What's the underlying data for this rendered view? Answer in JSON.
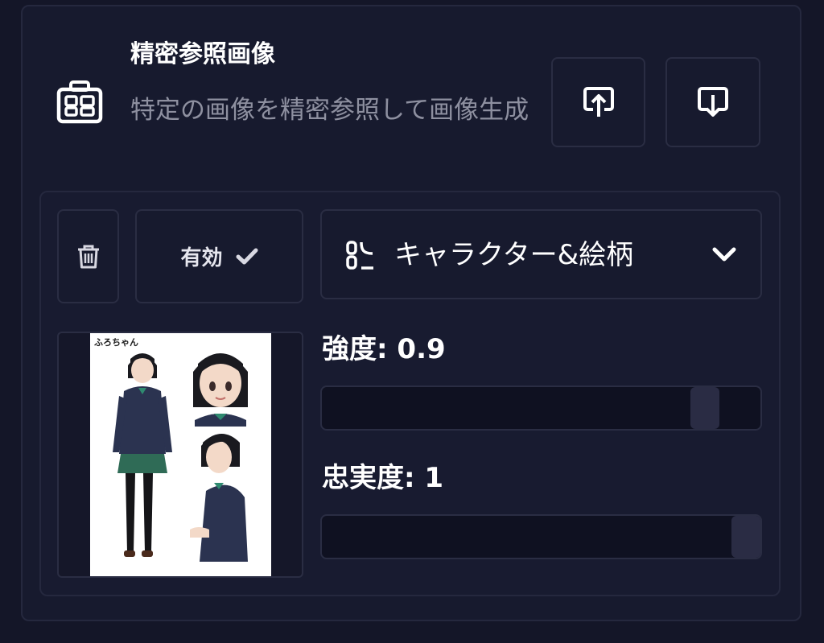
{
  "header": {
    "title": "精密参照画像",
    "description": "特定の画像を精密参照して画像生成",
    "icon": "id-card-icon"
  },
  "actions": {
    "upload_icon": "upload-icon",
    "download_icon": "download-icon"
  },
  "controls": {
    "delete_icon": "trash-icon",
    "enabled_label": "有効",
    "enabled_icon": "check-icon",
    "enabled": true
  },
  "mode_select": {
    "selected": "キャラクター&絵柄",
    "icon": "character-style-icon",
    "chevron": "chevron-down-icon"
  },
  "reference_image": {
    "caption": "ふろちゃん"
  },
  "sliders": {
    "strength": {
      "label": "強度: 0.9",
      "value": 0.9,
      "min": 0,
      "max": 1
    },
    "fidelity": {
      "label": "忠実度: 1",
      "value": 1,
      "min": 0,
      "max": 1
    }
  },
  "colors": {
    "background": "#141628",
    "panel": "#171a2e",
    "border": "#2a2d43",
    "track": "#0f1121",
    "thumb": "#2a2c44",
    "muted_text": "#8e90a0"
  }
}
